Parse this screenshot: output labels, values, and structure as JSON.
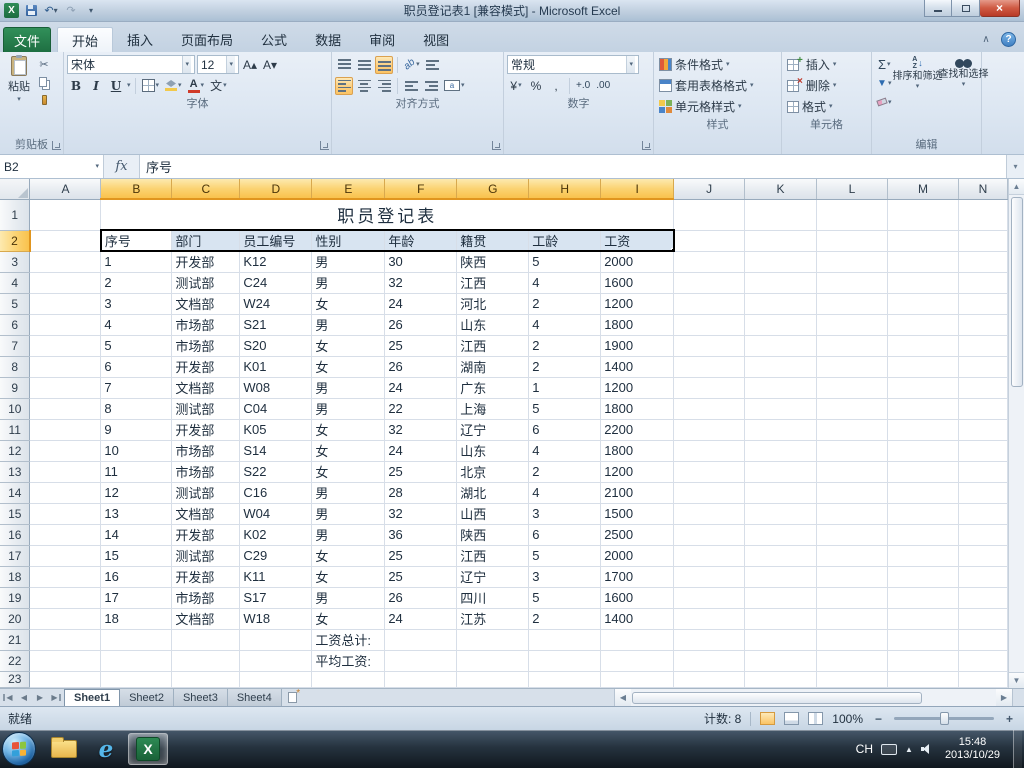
{
  "window": {
    "title": "职员登记表1  [兼容模式] -  Microsoft Excel"
  },
  "ribbon": {
    "file_tab": "文件",
    "tabs": [
      "开始",
      "插入",
      "页面布局",
      "公式",
      "数据",
      "审阅",
      "视图"
    ],
    "active_tab": "开始",
    "clipboard": {
      "paste": "粘贴",
      "group_label": "剪贴板"
    },
    "font": {
      "name": "宋体",
      "size": "12",
      "group_label": "字体"
    },
    "alignment": {
      "group_label": "对齐方式"
    },
    "number": {
      "format": "常规",
      "group_label": "数字"
    },
    "styles": {
      "items": [
        "条件格式",
        "套用表格格式",
        "单元格样式"
      ],
      "group_label": "样式"
    },
    "cells": {
      "items": [
        "插入",
        "删除",
        "格式"
      ],
      "group_label": "单元格"
    },
    "editing": {
      "items": [
        "排序和筛选",
        "查找和选择"
      ],
      "group_label": "编辑"
    },
    "icons": {
      "bold": "B",
      "italic": "I",
      "underline": "U",
      "sigma": "Σ",
      "currency": "¥",
      "percent": "%",
      "comma": ",",
      "inc_decimal": "+.0",
      "dec_decimal": ".00",
      "fx": "fx",
      "phonetic": "文",
      "grow_font": "A▴",
      "shrink_font": "A▾"
    }
  },
  "formula_bar": {
    "name_box": "B2",
    "content": "序号"
  },
  "sheet": {
    "columns": [
      "A",
      "B",
      "C",
      "D",
      "E",
      "F",
      "G",
      "H",
      "I",
      "J",
      "K",
      "L",
      "M",
      "N"
    ],
    "title": "职员登记表",
    "header_cells": [
      "序号",
      "部门",
      "员工编号",
      "性别",
      "年龄",
      "籍贯",
      "工龄",
      "工资"
    ],
    "data_rows": [
      [
        "1",
        "开发部",
        "K12",
        "男",
        "30",
        "陕西",
        "5",
        "2000"
      ],
      [
        "2",
        "测试部",
        "C24",
        "男",
        "32",
        "江西",
        "4",
        "1600"
      ],
      [
        "3",
        "文档部",
        "W24",
        "女",
        "24",
        "河北",
        "2",
        "1200"
      ],
      [
        "4",
        "市场部",
        "S21",
        "男",
        "26",
        "山东",
        "4",
        "1800"
      ],
      [
        "5",
        "市场部",
        "S20",
        "女",
        "25",
        "江西",
        "2",
        "1900"
      ],
      [
        "6",
        "开发部",
        "K01",
        "女",
        "26",
        "湖南",
        "2",
        "1400"
      ],
      [
        "7",
        "文档部",
        "W08",
        "男",
        "24",
        "广东",
        "1",
        "1200"
      ],
      [
        "8",
        "测试部",
        "C04",
        "男",
        "22",
        "上海",
        "5",
        "1800"
      ],
      [
        "9",
        "开发部",
        "K05",
        "女",
        "32",
        "辽宁",
        "6",
        "2200"
      ],
      [
        "10",
        "市场部",
        "S14",
        "女",
        "24",
        "山东",
        "4",
        "1800"
      ],
      [
        "11",
        "市场部",
        "S22",
        "女",
        "25",
        "北京",
        "2",
        "1200"
      ],
      [
        "12",
        "测试部",
        "C16",
        "男",
        "28",
        "湖北",
        "4",
        "2100"
      ],
      [
        "13",
        "文档部",
        "W04",
        "男",
        "32",
        "山西",
        "3",
        "1500"
      ],
      [
        "14",
        "开发部",
        "K02",
        "男",
        "36",
        "陕西",
        "6",
        "2500"
      ],
      [
        "15",
        "测试部",
        "C29",
        "女",
        "25",
        "江西",
        "5",
        "2000"
      ],
      [
        "16",
        "开发部",
        "K11",
        "女",
        "25",
        "辽宁",
        "3",
        "1700"
      ],
      [
        "17",
        "市场部",
        "S17",
        "男",
        "26",
        "四川",
        "5",
        "1600"
      ],
      [
        "18",
        "文档部",
        "W18",
        "女",
        "24",
        "江苏",
        "2",
        "1400"
      ]
    ],
    "footer_labels": [
      "工资总计:",
      "平均工资:"
    ]
  },
  "sheet_tabs": {
    "tabs": [
      "Sheet1",
      "Sheet2",
      "Sheet3",
      "Sheet4"
    ],
    "active": "Sheet1"
  },
  "status_bar": {
    "ready": "就绪",
    "count": "计数: 8",
    "zoom": "100%"
  },
  "taskbar": {
    "lang": "CH",
    "time": "15:48",
    "date": "2013/10/29"
  }
}
